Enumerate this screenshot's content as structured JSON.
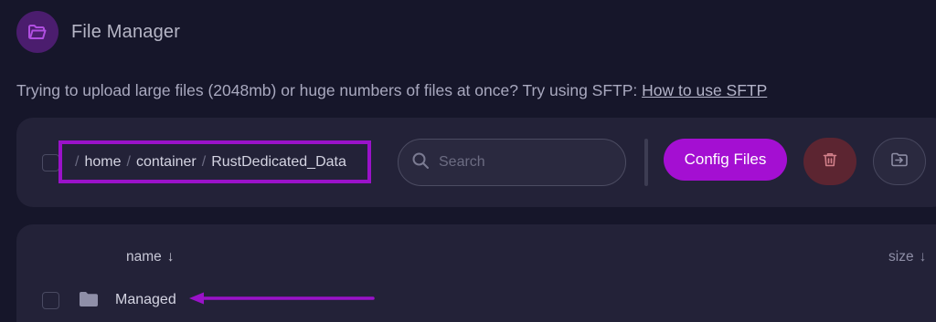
{
  "header": {
    "title": "File Manager",
    "icon": "folder-open-icon",
    "icon_bg": "#4b1d6e"
  },
  "notice": {
    "text": "Trying to upload large files (2048mb) or huge numbers of files at once? Try using SFTP: ",
    "link": "How to use SFTP"
  },
  "breadcrumb": {
    "separator": "/",
    "segments": [
      "home",
      "container",
      "RustDedicated_Data"
    ],
    "highlight_color": "#9a12c9"
  },
  "search": {
    "placeholder": "Search",
    "value": ""
  },
  "actions": {
    "config_label": "Config Files",
    "config_color": "#a40fd2",
    "delete_icon": "trash-icon",
    "delete_color": "#5c2531",
    "move_icon": "move-file-icon"
  },
  "file_list": {
    "columns": [
      {
        "label": "name",
        "sort": "↓"
      },
      {
        "label": "size",
        "sort": "↓"
      }
    ],
    "rows": [
      {
        "type": "folder",
        "name": "Managed",
        "icon": "folder-icon"
      }
    ]
  },
  "annotation": {
    "arrow_color": "#9a12c9"
  }
}
